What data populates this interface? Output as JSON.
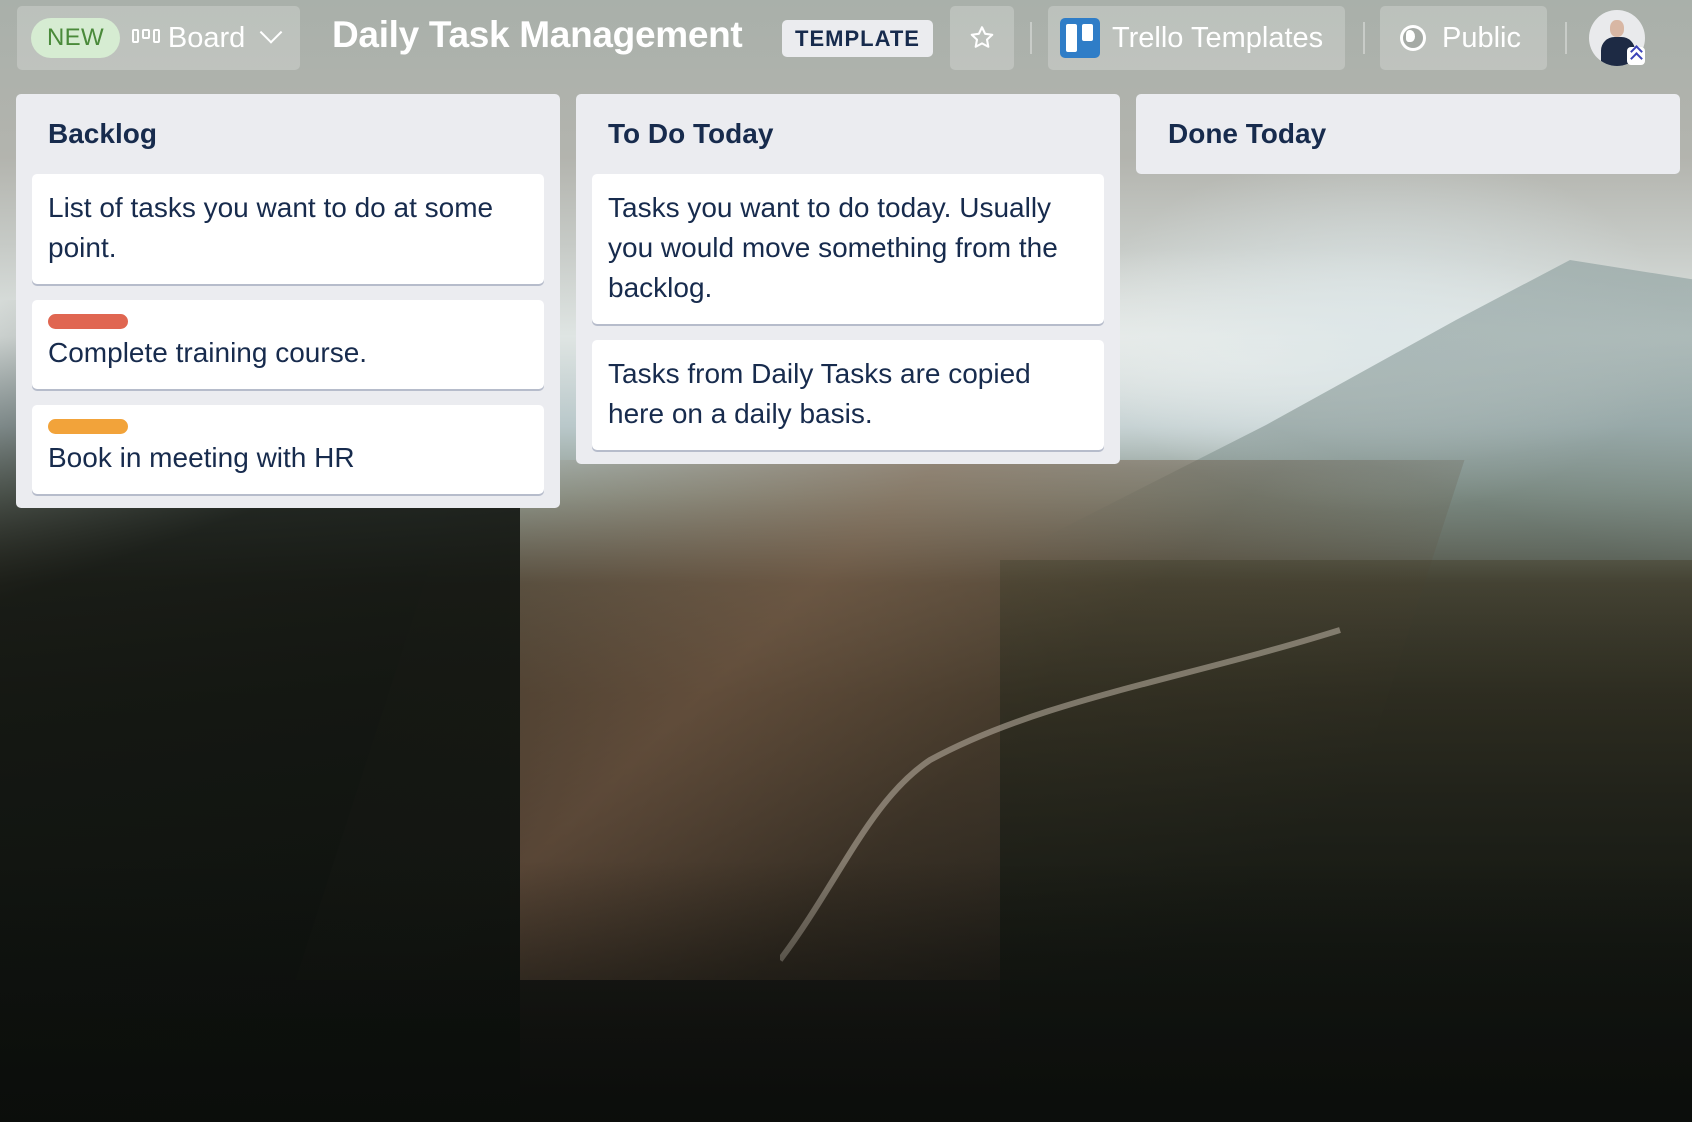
{
  "header": {
    "new_badge": "NEW",
    "view_label": "Board",
    "board_title": "Daily Task Management",
    "template_badge": "TEMPLATE",
    "workspace_label": "Trello Templates",
    "visibility_label": "Public"
  },
  "icons": {
    "board": "board-columns-icon",
    "view_dropdown": "chevron-down-icon",
    "star": "star-outline-icon",
    "workspace": "trello-logo-icon",
    "visibility": "globe-icon",
    "admin": "double-chevron-up-icon"
  },
  "colors": {
    "list_bg": "#ebecf0",
    "card_text": "#172b4d",
    "label_red": "#e06651",
    "label_orange": "#f2a33a",
    "new_badge_bg": "#d6ecd2",
    "new_badge_text": "#4a8a3a",
    "trello_blue": "#2f7dc7"
  },
  "lists": [
    {
      "title": "Backlog",
      "cards": [
        {
          "text": "List of tasks you want to do at some point.",
          "label_color": null
        },
        {
          "text": "Complete training course.",
          "label_color": "#e06651"
        },
        {
          "text": "Book in meeting with HR",
          "label_color": "#f2a33a"
        }
      ]
    },
    {
      "title": "To Do Today",
      "cards": [
        {
          "text": "Tasks you want to do today. Usually you would move something from the backlog.",
          "label_color": null
        },
        {
          "text": "Tasks from Daily Tasks are copied here on a daily basis.",
          "label_color": null
        }
      ]
    },
    {
      "title": "Done Today",
      "cards": []
    }
  ]
}
